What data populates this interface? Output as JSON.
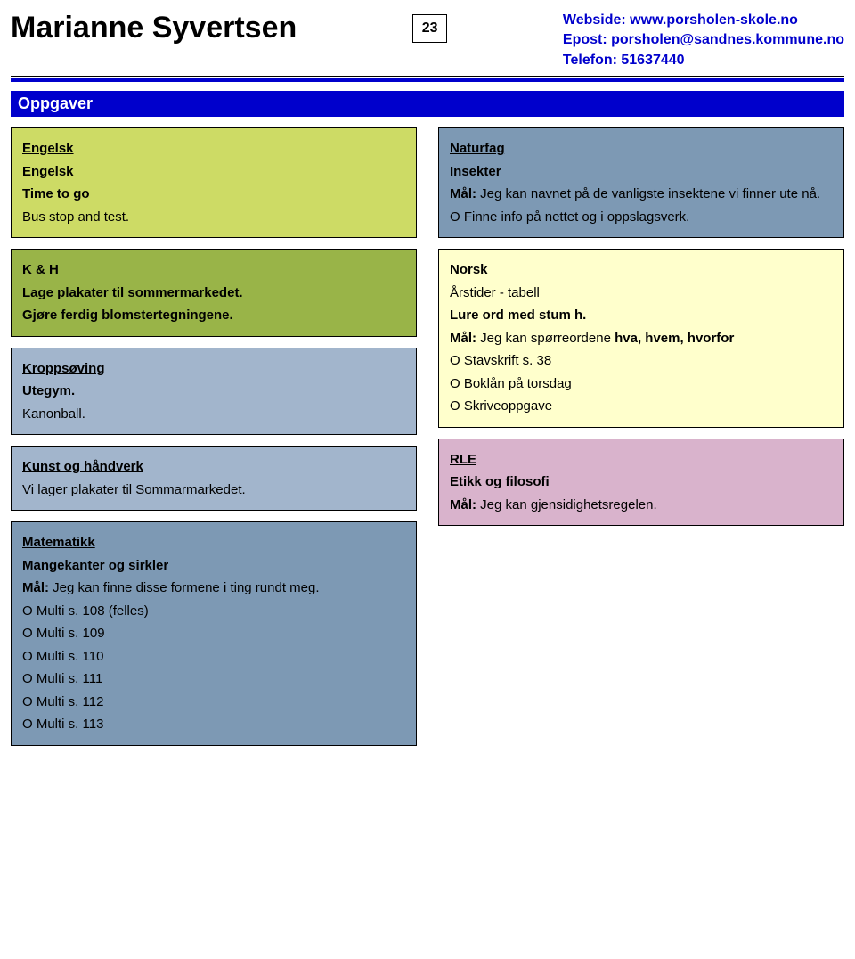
{
  "header": {
    "name": "Marianne Syvertsen",
    "week": "23",
    "contact": {
      "website": "Webside: www.porsholen-skole.no",
      "email": "Epost: porsholen@sandnes.kommune.no",
      "phone": "Telefon: 51637440"
    }
  },
  "section_title": "Oppgaver",
  "left": {
    "engelsk": {
      "title": "Engelsk",
      "sub": "Engelsk",
      "line1": "Time to go",
      "line2": "Bus stop and test."
    },
    "kh": {
      "title": "K & H",
      "line1": "Lage plakater til sommermarkedet.",
      "line2": "Gjøre ferdig blomstertegningene."
    },
    "kroppsoving": {
      "title": "Kroppsøving",
      "line1": "Utegym.",
      "line2": "Kanonball."
    },
    "kunsthandverk": {
      "title": "Kunst og håndverk",
      "line1": "Vi lager plakater til Sommarmarkedet."
    },
    "matte": {
      "title": "Matematikk",
      "sub": "Mangekanter og sirkler",
      "goal_label": "Mål:",
      "goal": " Jeg kan finne disse formene i ting rundt meg.",
      "items": [
        "O Multi s. 108 (felles)",
        "O Multi s. 109",
        "O Multi s. 110",
        "O Multi s. 111",
        "O Multi s. 112",
        "O Multi s. 113"
      ]
    }
  },
  "right": {
    "naturfag": {
      "title": "Naturfag",
      "sub": "Insekter",
      "goal_label": "Mål:",
      "goal": " Jeg kan navnet på de vanligste insektene vi finner ute nå.",
      "item1": "O Finne info på nettet og i oppslagsverk."
    },
    "norsk": {
      "title": "Norsk",
      "line1": "Årstider - tabell",
      "line2": "Lure ord med stum h.",
      "goal_label": "Mål:",
      "goal_pre": " Jeg kan spørreordene ",
      "goal_bold": "hva, hvem, hvorfor",
      "item1": "O Stavskrift s. 38",
      "item2": "O Boklån på torsdag",
      "item3": "O Skriveoppgave"
    },
    "rle": {
      "title": "RLE",
      "sub": "Etikk og filosofi",
      "goal_label": "Mål:",
      "goal": " Jeg kan gjensidighetsregelen."
    }
  }
}
